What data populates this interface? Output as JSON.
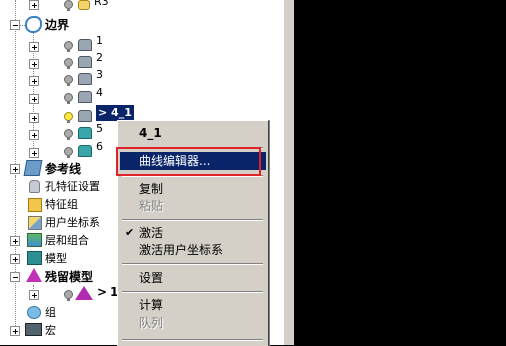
{
  "tree": {
    "r3_label": "R3",
    "boundary_label": "边界",
    "boundary_items": [
      "1",
      "2",
      "3",
      "4",
      "4_1",
      "5",
      "6"
    ],
    "selected_marker": ">",
    "ref_lines_label": "参考线",
    "hole_feature_label": "孔特征设置",
    "feature_group_label": "特征组",
    "user_cs_label": "用户坐标系",
    "layers_label": "层和组合",
    "model_label": "模型",
    "residual_model_label": "残留模型",
    "residual_item_label": "1",
    "group_label": "组",
    "macro_label": "宏"
  },
  "context_menu": {
    "title": "4_1",
    "curve_editor": "曲线编辑器...",
    "copy": "复制",
    "paste": "粘贴",
    "activate": "激活",
    "activate_ucs": "激活用户坐标系",
    "settings": "设置",
    "calculate": "计算",
    "queue": "队列",
    "check_mark": "✔"
  },
  "colors": {
    "selection": "#0a246a",
    "highlight_box": "#e0232b",
    "menu_bg": "#d4d0c8"
  }
}
